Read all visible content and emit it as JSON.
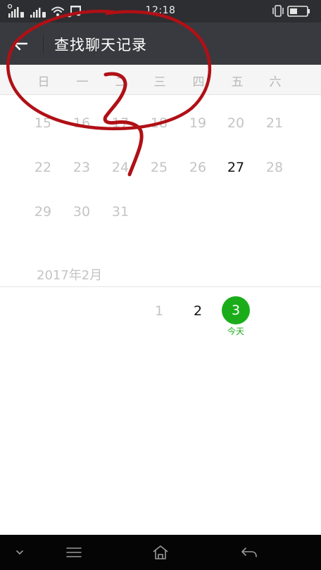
{
  "status_bar": {
    "time": "12:18"
  },
  "header": {
    "title": "查找聊天记录"
  },
  "weekdays": [
    "日",
    "一",
    "二",
    "三",
    "四",
    "五",
    "六"
  ],
  "calendar": {
    "rows": [
      [
        {
          "label": "15",
          "active": false
        },
        {
          "label": "16",
          "active": false
        },
        {
          "label": "17",
          "active": false
        },
        {
          "label": "18",
          "active": false
        },
        {
          "label": "19",
          "active": false
        },
        {
          "label": "20",
          "active": false
        },
        {
          "label": "21",
          "active": false
        }
      ],
      [
        {
          "label": "22",
          "active": false
        },
        {
          "label": "23",
          "active": false
        },
        {
          "label": "24",
          "active": false
        },
        {
          "label": "25",
          "active": false
        },
        {
          "label": "26",
          "active": false
        },
        {
          "label": "27",
          "active": true
        },
        {
          "label": "28",
          "active": false
        }
      ],
      [
        {
          "label": "29",
          "active": false
        },
        {
          "label": "30",
          "active": false
        },
        {
          "label": "31",
          "active": false
        }
      ]
    ],
    "next_month": {
      "label": "2017年2月",
      "day_1": "1",
      "day_2": "2",
      "today_day": "3",
      "today_label": "今天"
    }
  },
  "colors": {
    "title_bar": "#393a3f",
    "status_bar": "#2d2e31",
    "accent_green": "#1aad19",
    "annotation_red": "#b01016",
    "inactive_day": "#c4c4c4"
  },
  "icons": {
    "back": "arrow-left-icon",
    "nav_menu": "menu-icon",
    "nav_home": "home-icon",
    "nav_back": "return-icon",
    "nav_down": "chevron-down-icon"
  }
}
